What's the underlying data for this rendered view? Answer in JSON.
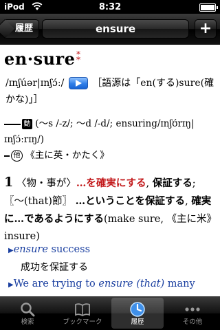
{
  "status_bar": {
    "carrier": "iPod",
    "time": "8:32"
  },
  "nav": {
    "back_label": "履歴",
    "title": "ensure",
    "add_label": "+"
  },
  "entry": {
    "headword": "en·sure",
    "freq_marks": "*\n*",
    "pron_a": "/ɪnʃúər|ɪnʃɔ́ː/",
    "etym": "［語源は「en(する)sure(確かな)」］",
    "inflect_label": "動",
    "inflect_text": "(～s /-z/; ～d /-d/; ensuring/ɪnʃʊ́rɪŋ|ɪnʃɔ́ːrɪŋ/)",
    "other_label": "他",
    "other_text": "《主に英・かたく》",
    "sense_num": "1",
    "sense_obj": "〈物・事が〉",
    "sense_red": "…を確実にする",
    "sense_b1": "保証する",
    "sense_mid": "; 〖～(that)節〗",
    "sense_b2": "…ということを保証する",
    "sense_b3": "確実に…であるようにする",
    "sense_tail": "(make sure, 《主に米》insure)",
    "example1_italic": "ensure",
    "example1_rest": " success",
    "example1_translation": "成功を保証する",
    "example2_a": "We are trying to ",
    "example2_italic": "ensure (that)",
    "example2_b": " many"
  },
  "tabs": [
    {
      "label": "検索",
      "icon": "search-icon"
    },
    {
      "label": "ブックマーク",
      "icon": "book-icon"
    },
    {
      "label": "履歴",
      "icon": "clock-icon",
      "selected": true
    },
    {
      "label": "その他",
      "icon": "more-icon"
    }
  ],
  "colors": {
    "accent_red": "#c2181a",
    "example_blue": "#1a3fa0"
  }
}
